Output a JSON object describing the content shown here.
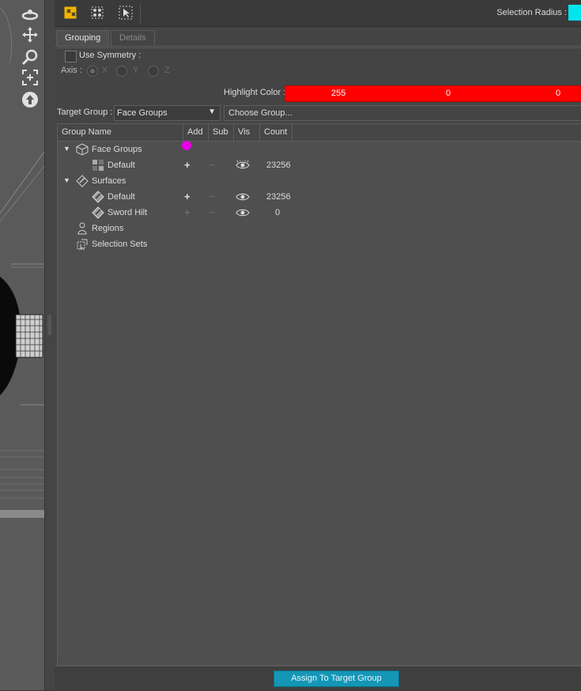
{
  "toolbar": {
    "selection_radius_label": "Selection Radius :",
    "selection_radius_color": "#00e5ee"
  },
  "tabs": [
    {
      "label": "Grouping",
      "active": true
    },
    {
      "label": "Details",
      "active": false
    }
  ],
  "symmetry": {
    "label": "Use Symmetry :",
    "checked": false,
    "axis_label": "Axis :",
    "axes": [
      "X",
      "Y",
      "Z"
    ],
    "selected_axis": "X"
  },
  "highlight": {
    "label": "Highlight Color :",
    "r": "255",
    "g": "0",
    "b": "0",
    "color": "#ff0000"
  },
  "target_group": {
    "label": "Target Group :",
    "value": "Face Groups",
    "choose_label": "Choose Group..."
  },
  "tree": {
    "columns": [
      "Group Name",
      "Add",
      "Sub",
      "Vis",
      "Count"
    ],
    "rows": [
      {
        "label": "Face Groups",
        "icon": "cube-icon",
        "expander": "▼",
        "count": ""
      },
      {
        "label": "Default",
        "icon": "face-group-icon",
        "add": "+",
        "sub": "−",
        "count": "23256"
      },
      {
        "label": "Surfaces",
        "icon": "surfaces-icon",
        "expander": "▼",
        "count": ""
      },
      {
        "label": "Default",
        "icon": "surface-icon",
        "add": "+",
        "sub": "−",
        "count": "23256"
      },
      {
        "label": "Sword Hilt",
        "icon": "surface-icon",
        "add": "+",
        "sub": "−",
        "count": "0"
      },
      {
        "label": "Regions",
        "icon": "figure-icon",
        "count": ""
      },
      {
        "label": "Selection Sets",
        "icon": "selection-set-icon",
        "count": ""
      }
    ]
  },
  "footer": {
    "assign_label": "Assign To Target Group",
    "accent": "#1496b6"
  }
}
